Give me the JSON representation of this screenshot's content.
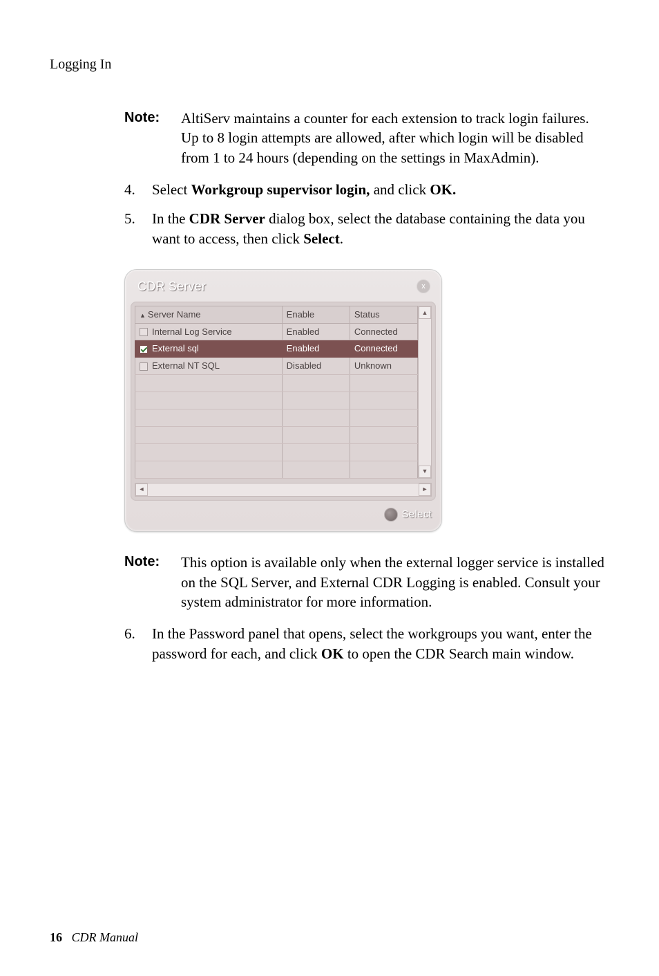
{
  "header": {
    "section_title": "Logging In"
  },
  "body": {
    "note1_label": "Note:",
    "note1_text": "AltiServ maintains a counter for each extension to track login failures. Up to 8 login attempts are allowed, after which login will be disabled from 1 to 24 hours (depending on the settings in MaxAdmin).",
    "step4_num": "4.",
    "step4_pre": "Select ",
    "step4_bold": "Workgroup supervisor login,",
    "step4_mid": " and click ",
    "step4_bold2": "OK.",
    "step5_num": "5.",
    "step5_pre": "In the ",
    "step5_bold": "CDR Server",
    "step5_mid": " dialog box, select the database containing the data you want to access, then click ",
    "step5_bold2": "Select",
    "step5_end": ".",
    "note2_label": "Note:",
    "note2_text": "This option is available only when the external logger service is installed on the SQL Server, and External CDR Logging is enabled. Consult your system administrator for more information.",
    "step6_num": "6.",
    "step6_pre": "In the Password panel that opens, select the workgroups you want, enter the password for each, and click ",
    "step6_bold": "OK",
    "step6_end": " to open the CDR Search main window."
  },
  "dialog": {
    "title": "CDR Server",
    "close_glyph": "x",
    "columns": {
      "c0": "Server Name",
      "c1": "Enable",
      "c2": "Status"
    },
    "rows": [
      {
        "name": "Internal Log Service",
        "enable": "Enabled",
        "status": "Connected",
        "checked": false,
        "selected": false
      },
      {
        "name": "External sql",
        "enable": "Enabled",
        "status": "Connected",
        "checked": true,
        "selected": true
      },
      {
        "name": "External NT SQL",
        "enable": "Disabled",
        "status": "Unknown",
        "checked": false,
        "selected": false
      }
    ],
    "select_label": "Select"
  },
  "footer": {
    "page_number": "16",
    "doc_title": "CDR Manual"
  },
  "chart_data": {
    "type": "table",
    "title": "CDR Server",
    "columns": [
      "Server Name",
      "Enable",
      "Status"
    ],
    "rows": [
      [
        "Internal Log Service",
        "Enabled",
        "Connected"
      ],
      [
        "External sql",
        "Enabled",
        "Connected"
      ],
      [
        "External NT SQL",
        "Disabled",
        "Unknown"
      ]
    ]
  }
}
